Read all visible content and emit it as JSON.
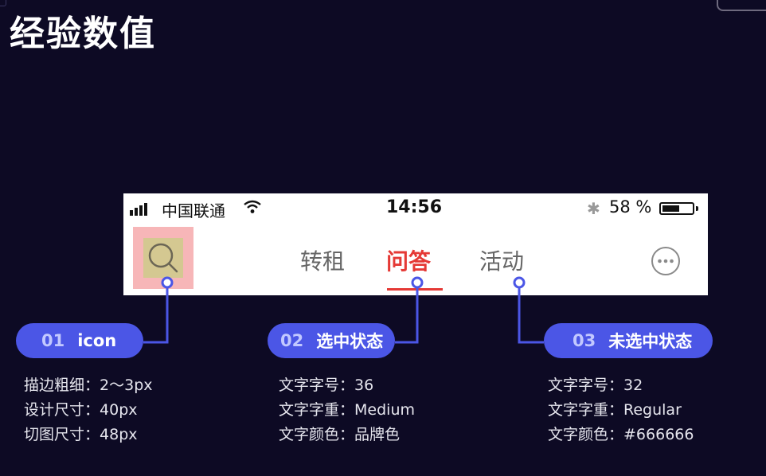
{
  "slide": {
    "title": "经验数值"
  },
  "status_bar": {
    "carrier": "中国联通",
    "time": "14:56",
    "battery_percent": "58 %",
    "battery_level": 0.58,
    "bluetooth_icon": "bluetooth-icon",
    "wifi_icon": "wifi-icon",
    "signal_icon": "signal-bars-icon"
  },
  "nav_bar": {
    "search_icon": "search-icon",
    "tabs": [
      {
        "label": "转租",
        "selected": false
      },
      {
        "label": "问答",
        "selected": true
      },
      {
        "label": "活动",
        "selected": false
      }
    ],
    "more_icon": "more-dots-icon",
    "selected_color": "#e53935",
    "unselected_color": "#666666"
  },
  "callouts": [
    {
      "number": "01",
      "label": "icon",
      "specs": [
        {
          "key": "描边粗细：",
          "value": "2～3px"
        },
        {
          "key": "设计尺寸：",
          "value": "40px"
        },
        {
          "key": "切图尺寸：",
          "value": "48px"
        }
      ]
    },
    {
      "number": "02",
      "label": "选中状态",
      "specs": [
        {
          "key": "文字字号：",
          "value": "36"
        },
        {
          "key": "文字字重：",
          "value": "Medium"
        },
        {
          "key": "文字颜色：",
          "value": "品牌色"
        }
      ]
    },
    {
      "number": "03",
      "label": "未选中状态",
      "specs": [
        {
          "key": "文字字号：",
          "value": "32"
        },
        {
          "key": "文字字重：",
          "value": "Regular"
        },
        {
          "key": "文字颜色：",
          "value": "#666666"
        }
      ]
    }
  ],
  "colors": {
    "background": "#0d0a24",
    "accent": "#4b56e6",
    "highlight": "#f7b6b8"
  }
}
